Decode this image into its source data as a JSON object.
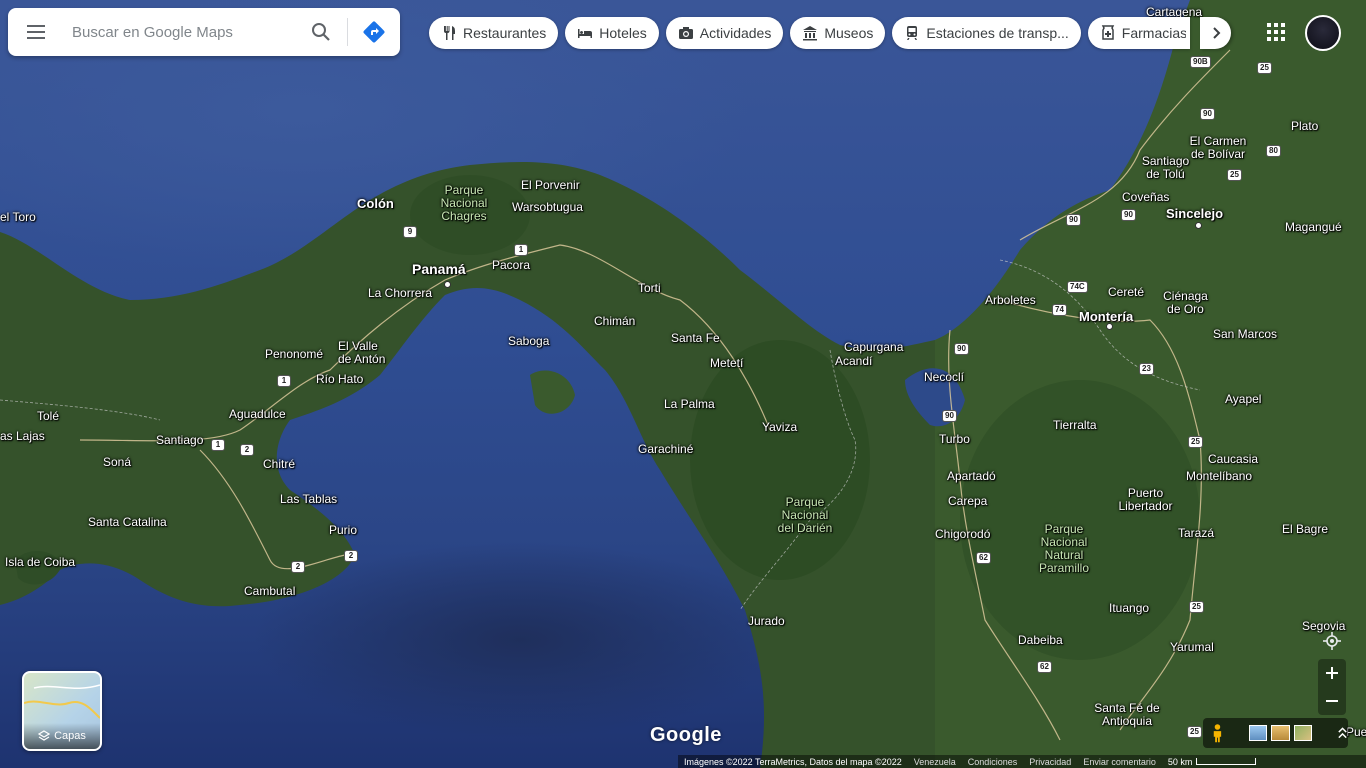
{
  "search": {
    "placeholder": "Buscar en Google Maps"
  },
  "chips": [
    {
      "icon": "fork-knife-icon",
      "label": "Restaurantes"
    },
    {
      "icon": "bed-icon",
      "label": "Hoteles"
    },
    {
      "icon": "camera-icon",
      "label": "Actividades"
    },
    {
      "icon": "museum-icon",
      "label": "Museos"
    },
    {
      "icon": "train-icon",
      "label": "Estaciones de transp..."
    },
    {
      "icon": "pharmacy-icon",
      "label": "Farmacias"
    }
  ],
  "layers": {
    "label": "Capas"
  },
  "logo": "Google",
  "footer": {
    "imagery": "Imágenes ©2022 TerraMetrics, Datos del mapa ©2022",
    "country": "Venezuela",
    "terms": "Condiciones",
    "privacy": "Privacidad",
    "feedback": "Enviar comentario",
    "scale": "50 km"
  },
  "map": {
    "places": {
      "bocas_del_toro": "el Toro",
      "colon": "Colón",
      "panama": "Panamá",
      "el_porvenir": "El Porvenir",
      "warsobtugua": "Warsobtugua",
      "pacora": "Pacora",
      "la_chorrera": "La Chorrera",
      "penonome": "Penonomé",
      "el_valle": "El Valle de Antón",
      "rio_hato": "Río Hato",
      "aguadulce": "Aguadulce",
      "tole": "Tolé",
      "las_lajas": "as Lajas",
      "santiago": "Santiago",
      "sona": "Soná",
      "chitre": "Chitré",
      "las_tablas": "Las Tablas",
      "purio": "Purio",
      "santa_catalina": "Santa Catalina",
      "isla_coiba": "Isla de Coiba",
      "cambutal": "Cambutal",
      "saboga": "Saboga",
      "chiman": "Chimán",
      "torti": "Torti",
      "santa_fe": "Santa Fe",
      "meteti": "Metetí",
      "la_palma": "La Palma",
      "yaviza": "Yaviza",
      "garachine": "Garachiné",
      "jurado": "Jurado",
      "capurgana": "Capurgana",
      "acandi": "Acandí",
      "necocli": "Necoclí",
      "turbo": "Turbo",
      "apartado": "Apartadó",
      "carepa": "Carepa",
      "chigorodo": "Chigorodó",
      "dabeiba": "Dabeiba",
      "santa_fe_antioquia": "Santa Fé de Antioquia",
      "cartagena": "Cartagena",
      "el_carmen": "El Carmen de Bolívar",
      "plato": "Plato",
      "santiago_tolu": "Santiago de Tolú",
      "covenas": "Coveñas",
      "sincelejo": "Sincelejo",
      "magangue": "Magangué",
      "arboletes": "Arboletes",
      "cerete": "Cereté",
      "cienaga_oro": "Ciénaga de Oro",
      "monteria": "Montería",
      "san_marcos": "San Marcos",
      "ayapel": "Ayapel",
      "tierralta": "Tierralta",
      "caucasia": "Caucasia",
      "montelibano": "Montelíbano",
      "puerto_libertador": "Puerto Libertador",
      "taraza": "Tarazá",
      "el_bagre": "El Bagre",
      "ituango": "Ituango",
      "segovia": "Segovia",
      "yarumal": "Yarumal",
      "puerto": "Puer"
    },
    "parks": {
      "chagres": "Parque Nacional Chagres",
      "darien": "Parque Nacional del Darién",
      "paramillo": "Parque Nacional Natural Paramillo"
    },
    "shields": {
      "r9": "9",
      "r1a": "1",
      "r1b": "1",
      "r1c": "1",
      "r2a": "2",
      "r2b": "2",
      "r2c": "2",
      "r90a": "90",
      "r90b": "90",
      "r90c": "90",
      "r90d": "90",
      "r90e": "90",
      "r90b_top": "90B",
      "r25a": "25",
      "r25b": "25",
      "r25c": "25",
      "r25d": "25",
      "r25e": "25",
      "r80": "80",
      "r74c": "74C",
      "r74": "74",
      "r23": "23",
      "r62a": "62",
      "r62b": "62"
    }
  },
  "colors": {
    "water": "#2f4d92",
    "land": "#34522a",
    "chip_bg": "#ffffff",
    "direction_blue": "#1a73e8"
  }
}
